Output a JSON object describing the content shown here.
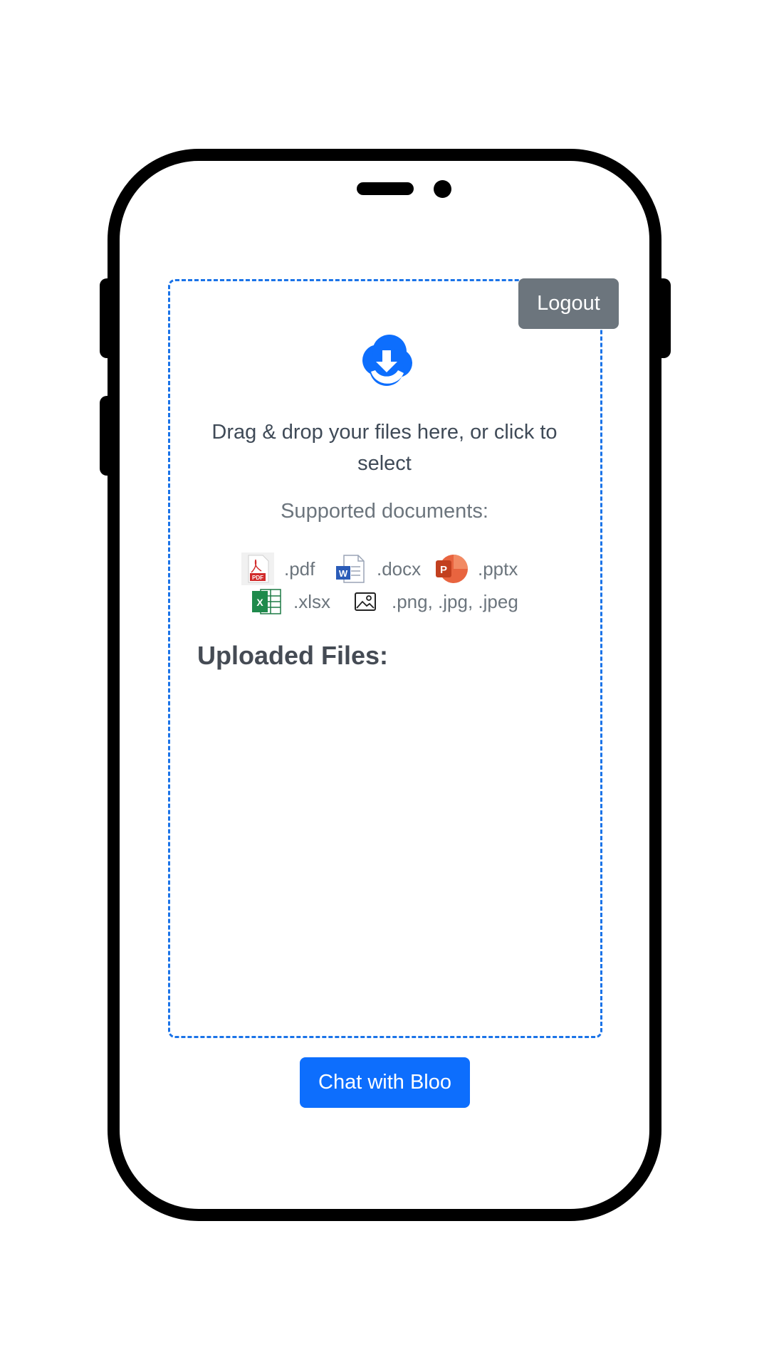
{
  "header": {
    "logout_label": "Logout"
  },
  "dropzone": {
    "icon": "cloud-download-icon",
    "instruction": "Drag & drop your files here, or click to select",
    "supported_title": "Supported documents:",
    "file_types": [
      {
        "icon": "pdf-file-icon",
        "label": ".pdf"
      },
      {
        "icon": "word-file-icon",
        "label": ".docx"
      },
      {
        "icon": "powerpoint-file-icon",
        "label": ".pptx"
      },
      {
        "icon": "excel-file-icon",
        "label": ".xlsx"
      },
      {
        "icon": "image-file-icon",
        "label": ".png, .jpg, .jpeg"
      }
    ],
    "uploaded_title": "Uploaded Files:",
    "uploaded_files": []
  },
  "footer": {
    "chat_label": "Chat with Bloo"
  },
  "colors": {
    "accent": "#0d6efd",
    "dropzone_border": "#1a73e8",
    "logout_bg": "#6c757d",
    "text_dark": "#3f4a57",
    "text_muted": "#6c757d"
  }
}
